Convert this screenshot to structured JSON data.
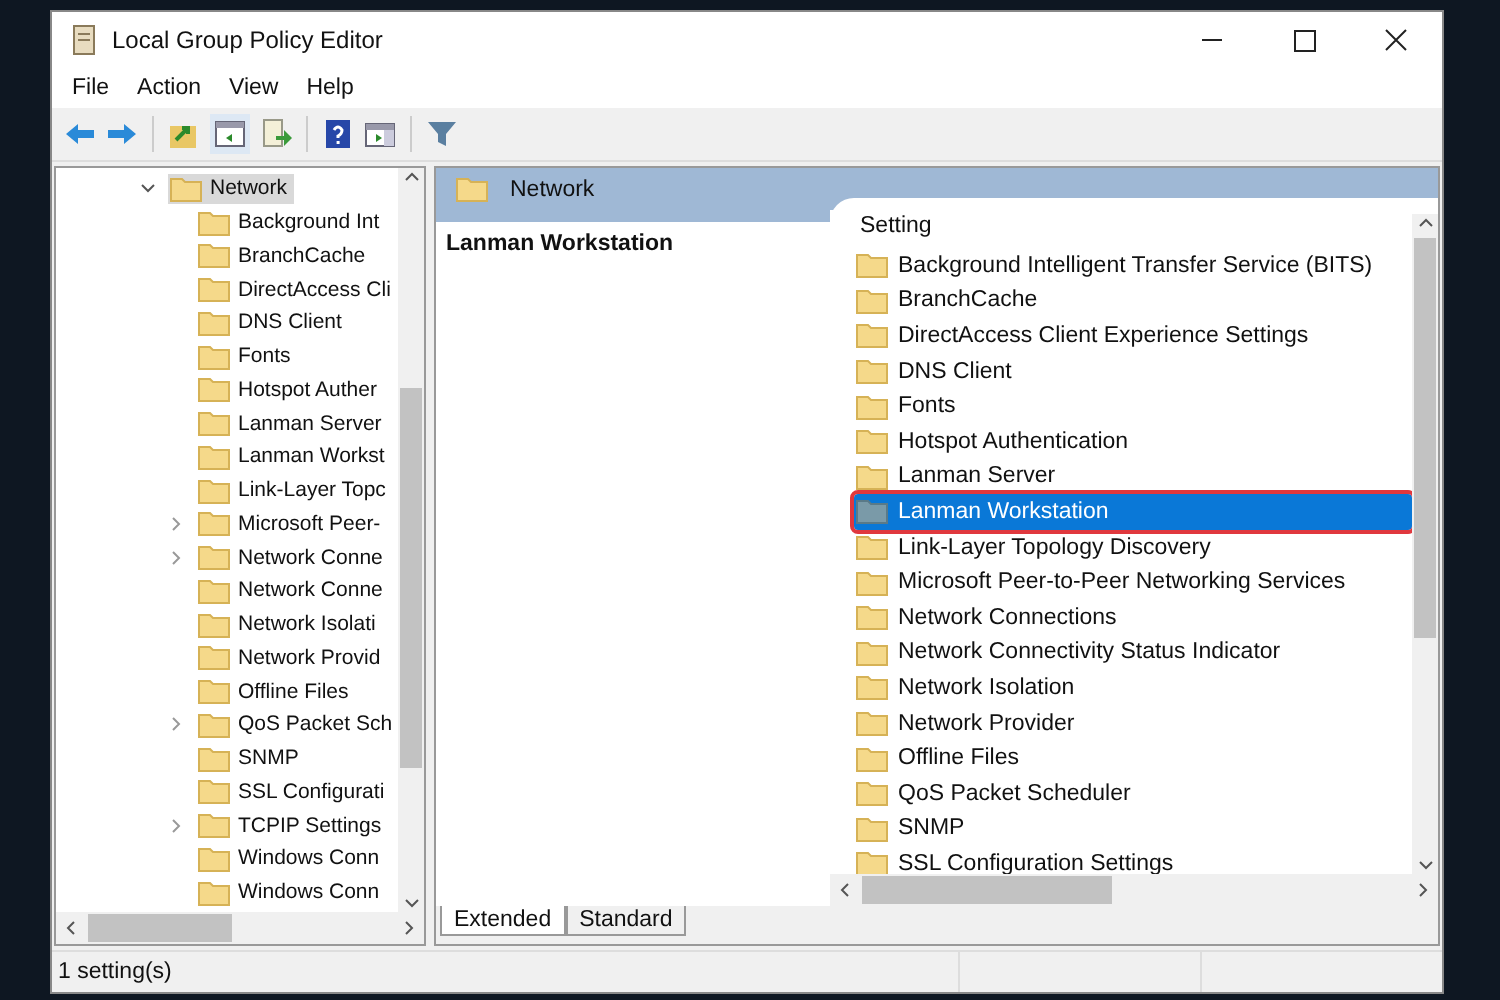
{
  "window": {
    "title": "Local Group Policy Editor"
  },
  "menu": [
    "File",
    "Action",
    "View",
    "Help"
  ],
  "tree": {
    "label": "Network",
    "expanded": true,
    "selected": true,
    "children": [
      {
        "label": "Background Int",
        "expandable": false,
        "selected": false
      },
      {
        "label": "BranchCache",
        "expandable": false,
        "selected": false
      },
      {
        "label": "DirectAccess Cli",
        "expandable": false,
        "selected": false
      },
      {
        "label": "DNS Client",
        "expandable": false,
        "selected": false
      },
      {
        "label": "Fonts",
        "expandable": false,
        "selected": false
      },
      {
        "label": "Hotspot Auther",
        "expandable": false,
        "selected": false
      },
      {
        "label": "Lanman Server",
        "expandable": false,
        "selected": false
      },
      {
        "label": "Lanman Workst",
        "expandable": false,
        "selected": false
      },
      {
        "label": "Link-Layer Topc",
        "expandable": false,
        "selected": false
      },
      {
        "label": "Microsoft Peer-",
        "expandable": true,
        "selected": false
      },
      {
        "label": "Network Conne",
        "expandable": true,
        "selected": false
      },
      {
        "label": "Network Conne",
        "expandable": false,
        "selected": false
      },
      {
        "label": "Network Isolati",
        "expandable": false,
        "selected": false
      },
      {
        "label": "Network Provid",
        "expandable": false,
        "selected": false
      },
      {
        "label": "Offline Files",
        "expandable": false,
        "selected": false
      },
      {
        "label": "QoS Packet Sch",
        "expandable": true,
        "selected": false
      },
      {
        "label": "SNMP",
        "expandable": false,
        "selected": false
      },
      {
        "label": "SSL Configurati",
        "expandable": false,
        "selected": false
      },
      {
        "label": "TCPIP Settings",
        "expandable": true,
        "selected": false
      },
      {
        "label": "Windows Conn",
        "expandable": false,
        "selected": false
      },
      {
        "label": "Windows Conn",
        "expandable": false,
        "selected": false
      }
    ]
  },
  "details": {
    "header": "Network",
    "description_title": "Lanman Workstation",
    "column": "Setting",
    "settings": [
      {
        "label": "Background Intelligent Transfer Service (BITS)",
        "selected": false,
        "outlined": false
      },
      {
        "label": "BranchCache",
        "selected": false,
        "outlined": false
      },
      {
        "label": "DirectAccess Client Experience Settings",
        "selected": false,
        "outlined": false
      },
      {
        "label": "DNS Client",
        "selected": false,
        "outlined": false
      },
      {
        "label": "Fonts",
        "selected": false,
        "outlined": false
      },
      {
        "label": "Hotspot Authentication",
        "selected": false,
        "outlined": false
      },
      {
        "label": "Lanman Server",
        "selected": false,
        "outlined": false
      },
      {
        "label": "Lanman Workstation",
        "selected": true,
        "outlined": true
      },
      {
        "label": "Link-Layer Topology Discovery",
        "selected": false,
        "outlined": false
      },
      {
        "label": "Microsoft Peer-to-Peer Networking Services",
        "selected": false,
        "outlined": false
      },
      {
        "label": "Network Connections",
        "selected": false,
        "outlined": false
      },
      {
        "label": "Network Connectivity Status Indicator",
        "selected": false,
        "outlined": false
      },
      {
        "label": "Network Isolation",
        "selected": false,
        "outlined": false
      },
      {
        "label": "Network Provider",
        "selected": false,
        "outlined": false
      },
      {
        "label": "Offline Files",
        "selected": false,
        "outlined": false
      },
      {
        "label": "QoS Packet Scheduler",
        "selected": false,
        "outlined": false
      },
      {
        "label": "SNMP",
        "selected": false,
        "outlined": false
      },
      {
        "label": "SSL Configuration Settings",
        "selected": false,
        "outlined": false
      }
    ],
    "tabs": [
      {
        "label": "Extended",
        "selected": true
      },
      {
        "label": "Standard",
        "selected": false
      }
    ]
  },
  "status_bar": "1 setting(s)"
}
